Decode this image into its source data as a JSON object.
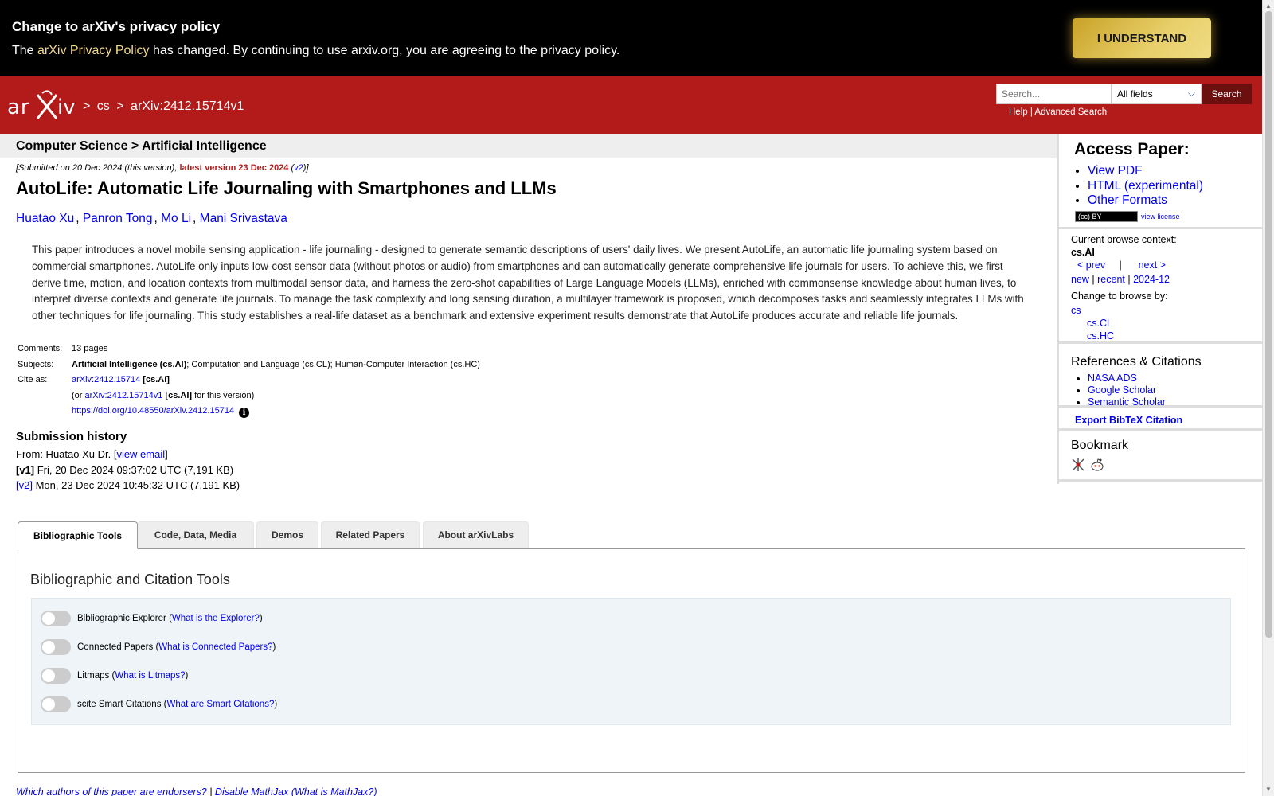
{
  "privacy_banner": {
    "title": "Change to arXiv's privacy policy",
    "text_before": "The ",
    "link": "arXiv Privacy Policy",
    "text_after": " has changed. By continuing to use arxiv.org, you are agreeing to the privacy policy.",
    "button": "I UNDERSTAND"
  },
  "header": {
    "logo_text": "arXiv",
    "breadcrumb": [
      ">",
      "cs",
      ">",
      "arXiv:2412.15714v1"
    ],
    "search_placeholder": "Search...",
    "field_select": "All fields",
    "search_button": "Search",
    "help": "Help",
    "separator": "|",
    "advanced": "Advanced Search"
  },
  "subheader": {
    "title": "Computer Science > Artificial Intelligence"
  },
  "paper": {
    "submitted_prefix": "[Submitted on 20 Dec 2024 (this version), ",
    "latest": "latest version 23 Dec 2024",
    "v2_link": "v2",
    "submitted_open": " (",
    "submitted_suffix": ")]",
    "title": "AutoLife: Automatic Life Journaling with Smartphones and LLMs",
    "authors": [
      "Huatao Xu",
      "Panron Tong",
      "Mo Li",
      "Mani Srivastava"
    ],
    "abstract": "This paper introduces a novel mobile sensing application - life journaling - designed to generate semantic descriptions of users' daily lives. We present AutoLife, an automatic life journaling system based on commercial smartphones. AutoLife only inputs low-cost sensor data (without photos or audio) from smartphones and can automatically generate comprehensive life journals for users. To achieve this, we first derive time, motion, and location contexts from multimodal sensor data, and harness the zero-shot capabilities of Large Language Models (LLMs), enriched with commonsense knowledge about human lives, to interpret diverse contexts and generate life journals. To manage the task complexity and long sensing duration, a multilayer framework is proposed, which decomposes tasks and seamlessly integrates LLMs with other techniques for life journaling. This study establishes a real-life dataset as a benchmark and extensive experiment results demonstrate that AutoLife produces accurate and reliable life journals."
  },
  "meta": {
    "comments_label": "Comments:",
    "comments": "13 pages",
    "subjects_label": "Subjects:",
    "subjects_primary": "Artificial Intelligence (cs.AI)",
    "subjects_rest": "; Computation and Language (cs.CL); Human-Computer Interaction (cs.HC)",
    "cite_label": "Cite as:",
    "cite_id": "arXiv:2412.15714",
    "cite_cat": "[cs.AI]",
    "or_prefix": "(or ",
    "cite_version": "arXiv:2412.15714v1",
    "or_suffix": " for this version)",
    "doi": "https://doi.org/10.48550/arXiv.2412.15714",
    "info_icon": "i"
  },
  "history": {
    "title": "Submission history",
    "from": "From: Huatao Xu Dr. [",
    "view_email": "view email",
    "from_close": "]",
    "v1_label": "[v1]",
    "v1": " Fri, 20 Dec 2024 09:37:02 UTC (7,191 KB)",
    "v2_label": "[v2]",
    "v2": " Mon, 23 Dec 2024 10:45:32 UTC (7,191 KB)"
  },
  "sidebar": {
    "access_title": "Access Paper:",
    "access_links": [
      "View PDF",
      "HTML (experimental)",
      "Other Formats"
    ],
    "license_badge": "(cc) BY",
    "view_license": "view license",
    "context_label": "Current browse context:",
    "context": "cs.AI",
    "prev": "< prev",
    "nav_sep": "|",
    "next": "next >",
    "new": "new",
    "recent": "recent",
    "month": "2024-12",
    "change_label": "Change to browse by:",
    "browse_cs": "cs",
    "browse_cl": "cs.CL",
    "browse_hc": "cs.HC",
    "refs_title": "References & Citations",
    "refs": [
      "NASA ADS",
      "Google Scholar",
      "Semantic Scholar"
    ],
    "bibtex": "Export BibTeX Citation",
    "bookmark_title": "Bookmark"
  },
  "tabs": [
    "Bibliographic Tools",
    "Code, Data, Media",
    "Demos",
    "Related Papers",
    "About arXivLabs"
  ],
  "tools_panel": {
    "title": "Bibliographic and Citation Tools",
    "tools": [
      {
        "name": "Bibliographic Explorer",
        "help": "What is the Explorer?"
      },
      {
        "name": "Connected Papers",
        "help": "What is Connected Papers?"
      },
      {
        "name": "Litmaps",
        "help": "What is Litmaps?"
      },
      {
        "name": "scite Smart Citations",
        "help": "What are Smart Citations?"
      }
    ]
  },
  "footer": {
    "endorsers": "Which authors of this paper are endorsers?",
    "sep": " | ",
    "mathjax": "Disable MathJax",
    "what_mathjax": "(What is MathJax?)"
  }
}
